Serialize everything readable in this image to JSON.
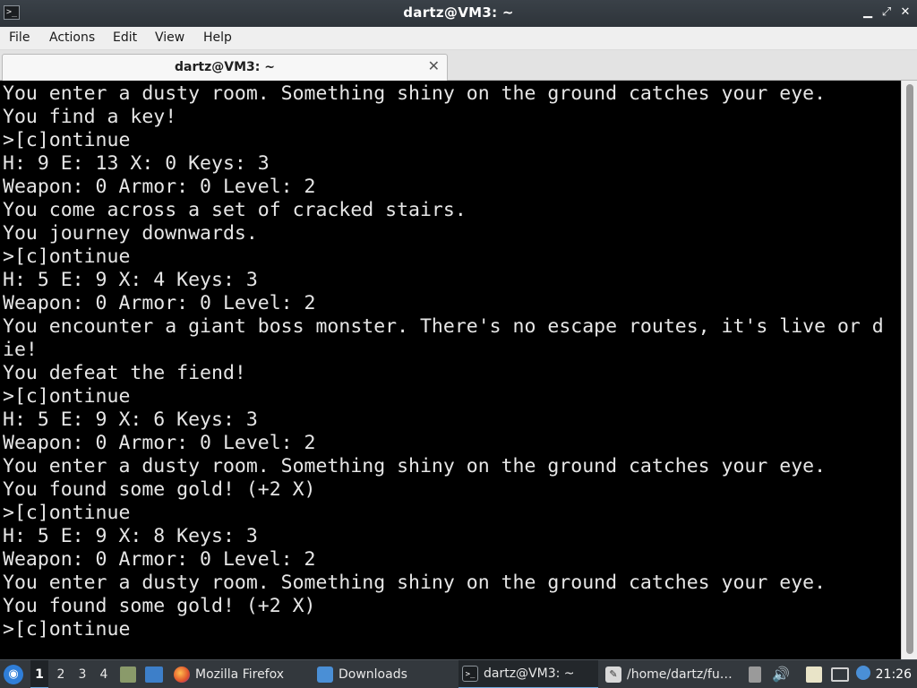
{
  "window": {
    "title": "dartz@VM3: ~",
    "minimize_glyph": "▁",
    "maximize_glyph": "⤢",
    "close_glyph": "✕"
  },
  "menu": {
    "items": [
      "File",
      "Actions",
      "Edit",
      "View",
      "Help"
    ]
  },
  "tab": {
    "label": "dartz@VM3: ~",
    "close_glyph": "✕"
  },
  "terminal": {
    "lines": [
      "You enter a dusty room. Something shiny on the ground catches your eye.",
      "You find a key!",
      ">[c]ontinue",
      "H: 9 E: 13 X: 0 Keys: 3",
      "Weapon: 0 Armor: 0 Level: 2",
      "You come across a set of cracked stairs.",
      "You journey downwards.",
      ">[c]ontinue",
      "H: 5 E: 9 X: 4 Keys: 3",
      "Weapon: 0 Armor: 0 Level: 2",
      "You encounter a giant boss monster. There's no escape routes, it's live or d",
      "ie!",
      "You defeat the fiend!",
      ">[c]ontinue",
      "H: 5 E: 9 X: 6 Keys: 3",
      "Weapon: 0 Armor: 0 Level: 2",
      "You enter a dusty room. Something shiny on the ground catches your eye.",
      "You found some gold! (+2 X)",
      ">[c]ontinue",
      "H: 5 E: 9 X: 8 Keys: 3",
      "Weapon: 0 Armor: 0 Level: 2",
      "You enter a dusty room. Something shiny on the ground catches your eye.",
      "You found some gold! (+2 X)",
      ">[c]ontinue"
    ]
  },
  "taskbar": {
    "workspaces": [
      "1",
      "2",
      "3",
      "4"
    ],
    "active_workspace": "1",
    "tasks": [
      {
        "label": "Mozilla Firefox",
        "icon": "firefox-icon"
      },
      {
        "label": "Downloads",
        "icon": "folder-icon"
      },
      {
        "label": "dartz@VM3: ~",
        "icon": "terminal-icon"
      },
      {
        "label": "/home/dartz/fu…",
        "icon": "text-editor-icon"
      }
    ],
    "clock": "21:26"
  },
  "colors": {
    "terminal_bg": "#000000",
    "terminal_fg": "#e6e6e6",
    "accent": "#6fa8dc"
  }
}
